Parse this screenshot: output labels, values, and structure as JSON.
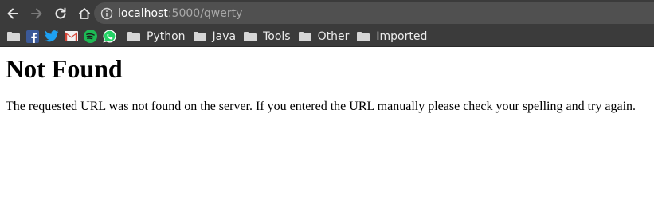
{
  "browser": {
    "url_host": "localhost",
    "url_path": ":5000/qwerty",
    "nav_icons": [
      "back-arrow-icon",
      "forward-arrow-icon",
      "reload-icon",
      "home-icon",
      "info-icon"
    ],
    "bookmarks": {
      "icons": [
        "folder-icon",
        "facebook-icon",
        "twitter-icon",
        "gmail-icon",
        "spotify-icon",
        "whatsapp-icon"
      ],
      "folders": [
        {
          "label": "Python"
        },
        {
          "label": "Java"
        },
        {
          "label": "Tools"
        },
        {
          "label": "Other"
        },
        {
          "label": "Imported"
        }
      ]
    }
  },
  "page": {
    "heading": "Not Found",
    "message": "The requested URL was not found on the server. If you entered the URL manually please check your spelling and try again."
  },
  "colors": {
    "chrome_bg": "#3b3b3b",
    "omnibox_bg": "#505050",
    "facebook": "#3b5998",
    "twitter": "#1da1f2",
    "gmail": "#d44638",
    "spotify": "#1db954",
    "whatsapp": "#25d366"
  }
}
